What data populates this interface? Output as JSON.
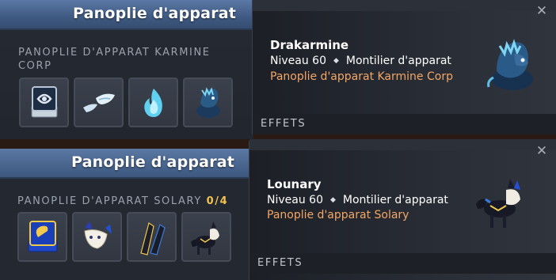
{
  "panels": [
    {
      "title": "Panoplie d'apparat",
      "set_label": "PANOPLIE D'APPARAT KARMINE CORP",
      "items": [
        {
          "name": "karmine-banner",
          "icon": "banner-icon"
        },
        {
          "name": "karmine-wings",
          "icon": "wings-icon"
        },
        {
          "name": "karmine-flame",
          "icon": "flame-icon"
        },
        {
          "name": "drakarmine",
          "icon": "mount-icon"
        }
      ]
    },
    {
      "title": "Panoplie d'apparat",
      "set_label": "PANOPLIE D'APPARAT SOLARY",
      "count": "0/4",
      "items": [
        {
          "name": "solary-banner",
          "icon": "banner-icon"
        },
        {
          "name": "solary-mask",
          "icon": "mask-icon"
        },
        {
          "name": "solary-blades",
          "icon": "blades-icon"
        },
        {
          "name": "lounary",
          "icon": "mount-icon"
        }
      ]
    }
  ],
  "tooltips": [
    {
      "name": "Drakarmine",
      "level": "Niveau 60",
      "category": "Montilier d'apparat",
      "set": "Panoplie d'apparat Karmine Corp",
      "effects_label": "EFFETS",
      "close": "✕"
    },
    {
      "name": "Lounary",
      "level": "Niveau 60",
      "category": "Montilier d'apparat",
      "set": "Panoplie d'apparat Solary",
      "effects_label": "EFFETS",
      "close": "✕"
    }
  ],
  "colors": {
    "set_link": "#f2a766",
    "count": "#f3c24f",
    "titlebar": "#4a6894",
    "panel_bg": "#262a33"
  }
}
